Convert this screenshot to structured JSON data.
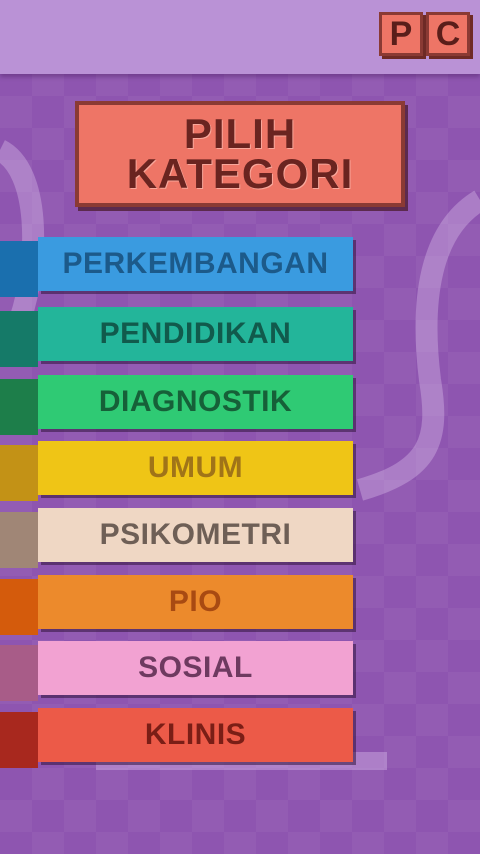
{
  "header": {
    "logo_letters": [
      "P",
      "C"
    ]
  },
  "title": {
    "line1": "PILIH",
    "line2": "KATEGORI"
  },
  "categories": [
    {
      "label": "PERKEMBANGAN",
      "face": "#3a9be0",
      "stub": "#1a6fae",
      "text": "#1c5a8a"
    },
    {
      "label": "PENDIDIKAN",
      "face": "#23b59a",
      "stub": "#157a68",
      "text": "#115a4c"
    },
    {
      "label": "DIAGNOSTIK",
      "face": "#2fca74",
      "stub": "#1d7e4a",
      "text": "#166038"
    },
    {
      "label": "UMUM",
      "face": "#efc516",
      "stub": "#c39216",
      "text": "#a07418"
    },
    {
      "label": "PSIKOMETRI",
      "face": "#efd7c4",
      "stub": "#a08676",
      "text": "#6e5f56"
    },
    {
      "label": "PIO",
      "face": "#ec8a2c",
      "stub": "#d45b0c",
      "text": "#a84a12"
    },
    {
      "label": "SOSIAL",
      "face": "#f2a2d2",
      "stub": "#a85c88",
      "text": "#6e3a60"
    },
    {
      "label": "KLINIS",
      "face": "#ec5a48",
      "stub": "#a8281e",
      "text": "#7a1e16"
    }
  ]
}
